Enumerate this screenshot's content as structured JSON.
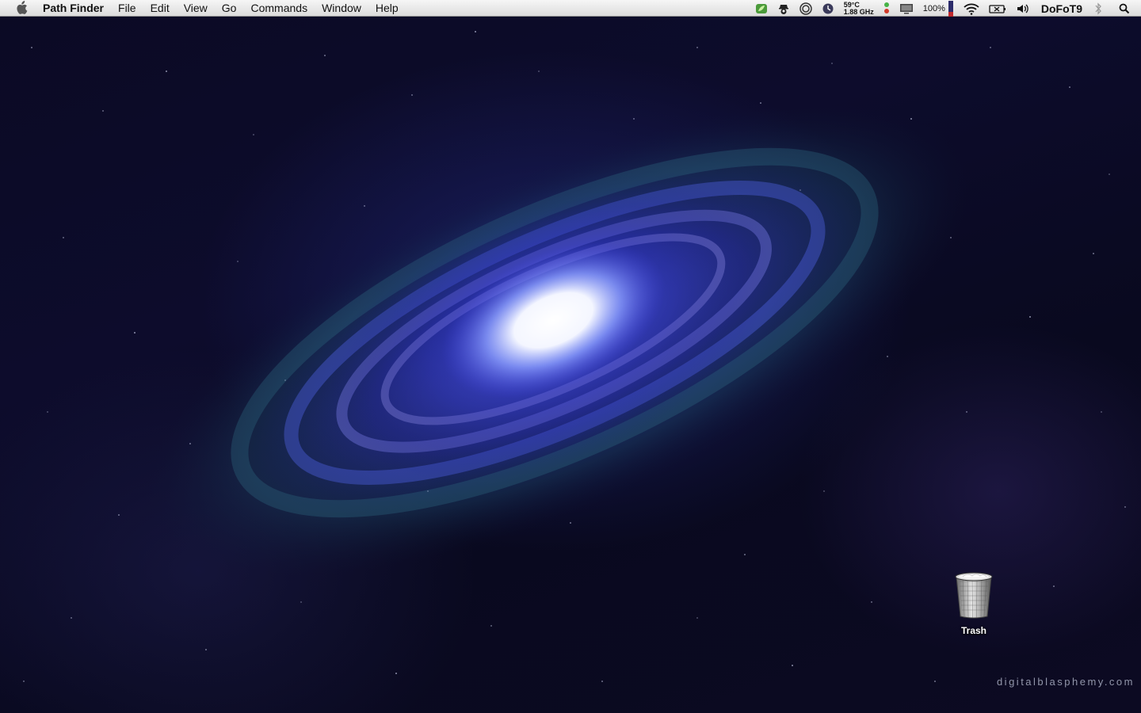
{
  "menubar": {
    "app_name": "Path Finder",
    "menus": [
      "File",
      "Edit",
      "View",
      "Go",
      "Commands",
      "Window",
      "Help"
    ],
    "status": {
      "cpu_temp": "59°C",
      "cpu_speed": "1.88 GHz",
      "battery": "100%",
      "user": "DoFoT9"
    },
    "icons": [
      "apple-icon",
      "leaf-icon",
      "spy-icon",
      "app-circle-icon",
      "clock-dial-icon",
      "traffic-light-icon",
      "display-icon",
      "battery-icon",
      "wifi-icon",
      "time-machine-icon",
      "volume-icon",
      "bluetooth-icon",
      "spotlight-icon"
    ]
  },
  "desktop": {
    "trash_label": "Trash",
    "watermark": "digitalblasphemy.com"
  }
}
